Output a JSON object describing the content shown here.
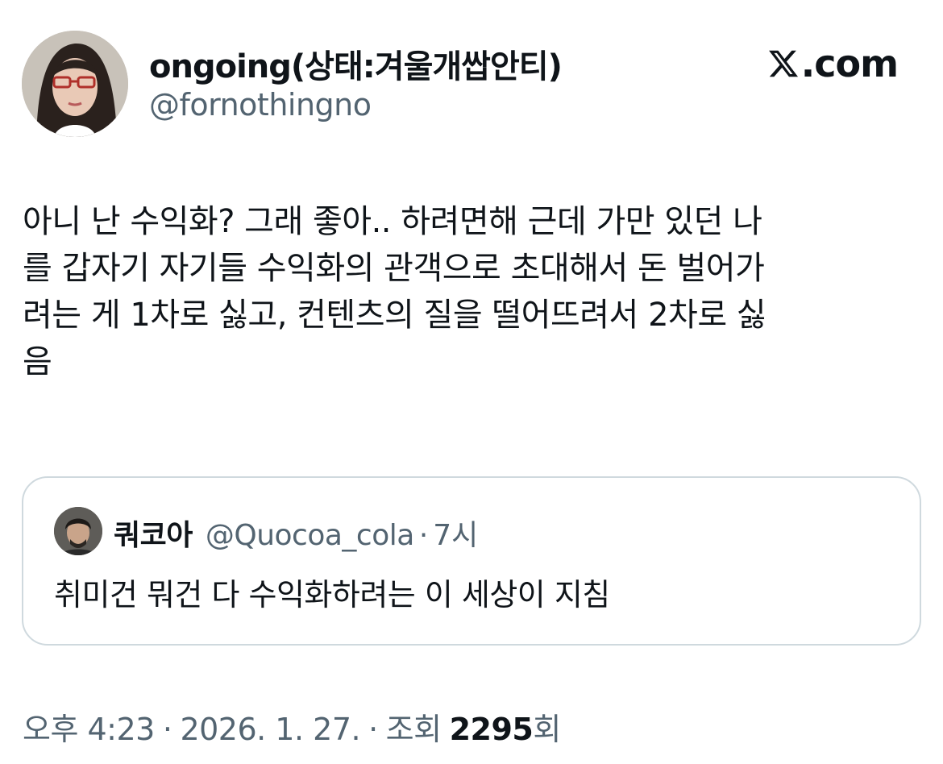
{
  "author": {
    "display_name": "ongoing(상태:겨울개쌉안티)",
    "handle": "@fornothingno",
    "avatar_icon": "profile-photo"
  },
  "brand": {
    "icon": "x-logo-icon",
    "text": ".com"
  },
  "tweet": {
    "lines": [
      "아니 난 수익화? 그래 좋아.. 하려면해 근데 가만 있던 나",
      "를 갑자기 자기들 수익화의 관객으로 초대해서 돈 벌어가",
      "려는 게 1차로 싫고, 컨텐츠의 질을 떨어뜨려서 2차로 싫",
      "음"
    ]
  },
  "quoted": {
    "display_name": "쿼코아",
    "handle": "@Quocoa_cola",
    "separator": "·",
    "time": "7시",
    "text": "취미건 뭐건 다 수익화하려는 이 세상이 지침"
  },
  "meta": {
    "time": "오후 4:23",
    "sep1": "·",
    "date": "2026. 1. 27.",
    "sep2": "·",
    "views_label": "조회",
    "views_count": "2295",
    "views_suffix": "회"
  },
  "colors": {
    "text": "#0f1419",
    "secondary": "#536471",
    "border": "#cfd9de"
  }
}
